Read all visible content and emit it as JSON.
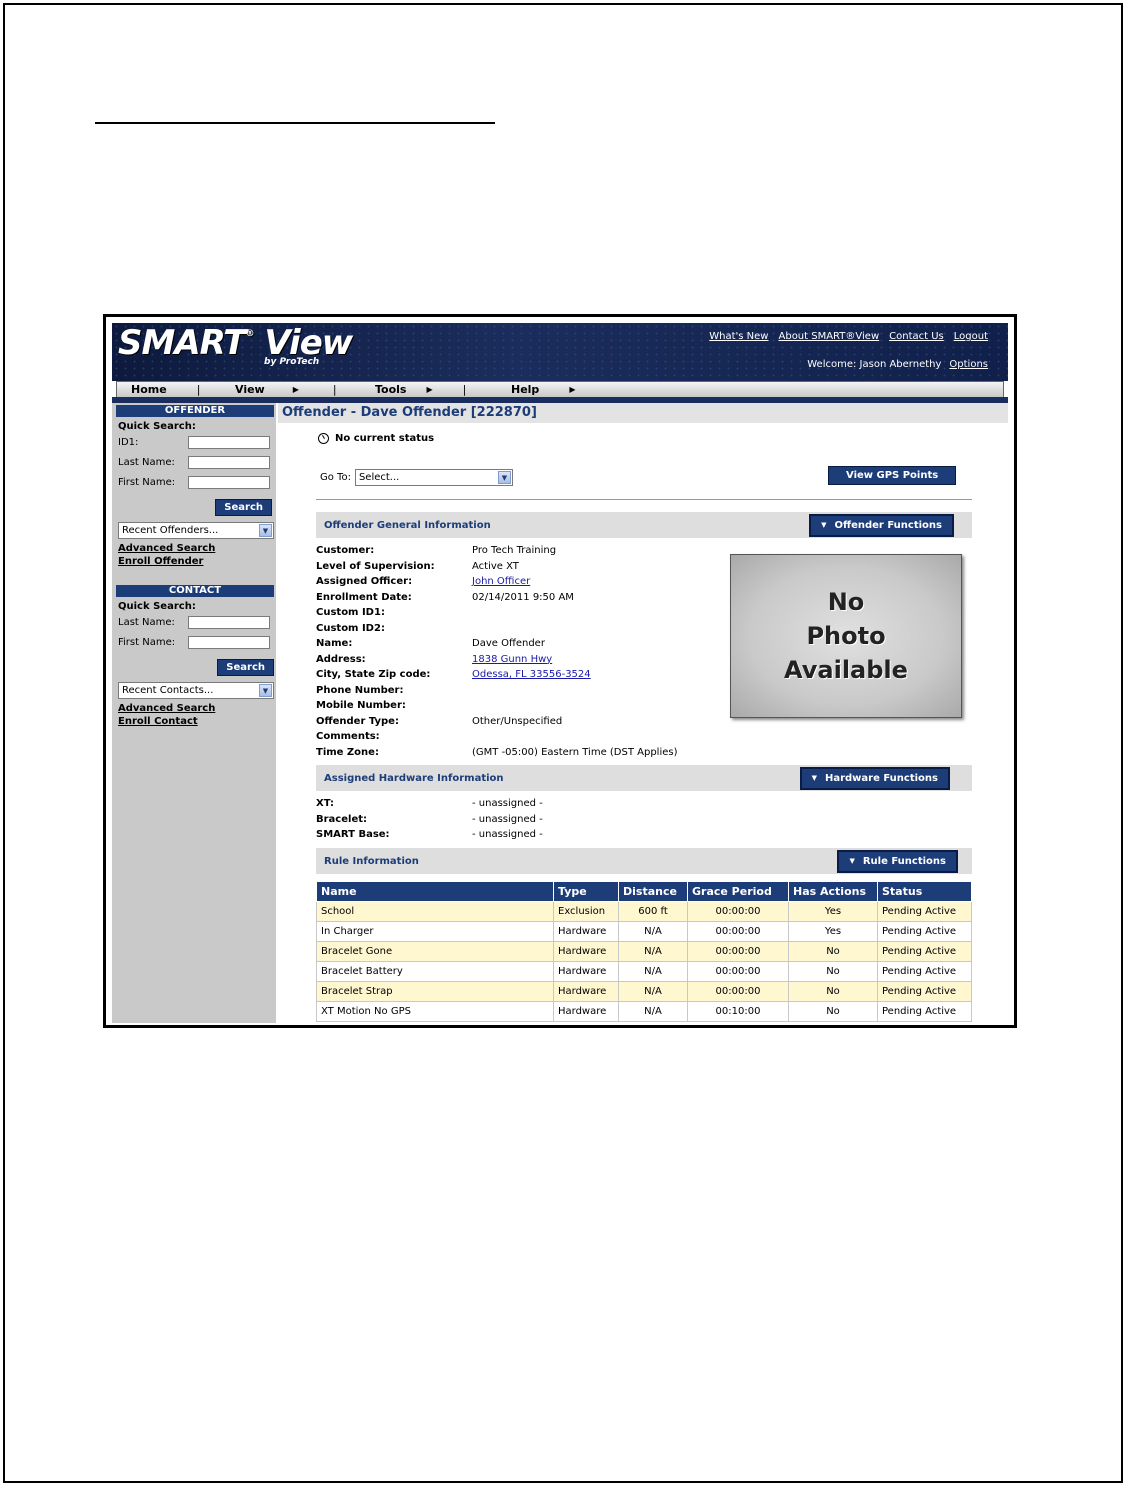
{
  "header": {
    "logo_main": "SMART",
    "logo_reg": "®",
    "logo_view": " View",
    "logo_sub": "by ProTech",
    "links": [
      "What's New",
      "About SMART®View",
      "Contact Us",
      "Logout"
    ],
    "welcome": "Welcome: Jason Abernethy",
    "options": "Options"
  },
  "menu": {
    "home": "Home",
    "view": "View",
    "tools": "Tools",
    "help": "Help"
  },
  "sidebar": {
    "offender_header": "OFFENDER",
    "offender_quick": "Quick Search:",
    "id1_label": "ID1:",
    "last_name_label": "Last Name:",
    "first_name_label": "First Name:",
    "search_button": "Search",
    "recent_offenders": "Recent Offenders...",
    "advanced_search": "Advanced Search",
    "enroll_offender": "Enroll Offender",
    "contact_header": "CONTACT",
    "contact_quick": "Quick Search:",
    "c_last_name_label": "Last Name:",
    "c_first_name_label": "First Name:",
    "c_search_button": "Search",
    "recent_contacts": "Recent Contacts...",
    "c_advanced_search": "Advanced Search",
    "enroll_contact": "Enroll Contact"
  },
  "main": {
    "page_title": "Offender - Dave Offender [222870]",
    "status": "No current status",
    "goto_label": "Go To:",
    "goto_value": "Select...",
    "gps_button": "View GPS Points",
    "general_title": "Offender General Information",
    "offender_functions": "Offender Functions",
    "general": [
      {
        "k": "Customer:",
        "v": "Pro Tech Training"
      },
      {
        "k": "Level of Supervision:",
        "v": "Active XT"
      },
      {
        "k": "Assigned Officer:",
        "v": "John Officer",
        "link": true
      },
      {
        "k": "Enrollment Date:",
        "v": "02/14/2011 9:50 AM"
      },
      {
        "k": "Custom ID1:",
        "v": ""
      },
      {
        "k": "Custom ID2:",
        "v": ""
      },
      {
        "k": "Name:",
        "v": "Dave Offender"
      },
      {
        "k": "Address:",
        "v": "1838 Gunn Hwy",
        "link": true
      },
      {
        "k": "City, State Zip code:",
        "v": "Odessa, FL 33556-3524",
        "link": true
      },
      {
        "k": "Phone Number:",
        "v": ""
      },
      {
        "k": "Mobile Number:",
        "v": ""
      },
      {
        "k": "Offender Type:",
        "v": "Other/Unspecified"
      },
      {
        "k": "Comments:",
        "v": ""
      },
      {
        "k": "Time Zone:",
        "v": "(GMT -05:00) Eastern Time (DST Applies)"
      }
    ],
    "photo_lines": [
      "No",
      "Photo",
      "Available"
    ],
    "hardware_title": "Assigned Hardware Information",
    "hardware_functions": "Hardware Functions",
    "hardware": [
      {
        "k": "XT:",
        "v": "- unassigned -"
      },
      {
        "k": "Bracelet:",
        "v": "- unassigned -"
      },
      {
        "k": "SMART Base:",
        "v": "- unassigned -"
      }
    ],
    "rule_title": "Rule Information",
    "rule_functions": "Rule Functions",
    "rule_headers": [
      "Name",
      "Type",
      "Distance",
      "Grace Period",
      "Has Actions",
      "Status"
    ],
    "rules": [
      [
        "School",
        "Exclusion",
        "600 ft",
        "00:00:00",
        "Yes",
        "Pending Active"
      ],
      [
        "In Charger",
        "Hardware",
        "N/A",
        "00:00:00",
        "Yes",
        "Pending Active"
      ],
      [
        "Bracelet Gone",
        "Hardware",
        "N/A",
        "00:00:00",
        "No",
        "Pending Active"
      ],
      [
        "Bracelet Battery",
        "Hardware",
        "N/A",
        "00:00:00",
        "No",
        "Pending Active"
      ],
      [
        "Bracelet Strap",
        "Hardware",
        "N/A",
        "00:00:00",
        "No",
        "Pending Active"
      ],
      [
        "XT Motion No GPS",
        "Hardware",
        "N/A",
        "00:10:00",
        "No",
        "Pending Active"
      ]
    ]
  }
}
